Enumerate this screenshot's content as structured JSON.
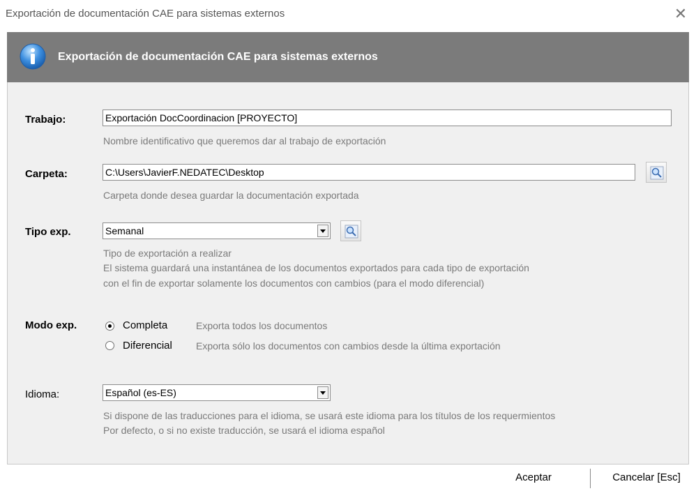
{
  "window": {
    "title": "Exportación de documentación CAE para sistemas externos",
    "close_glyph": "✕"
  },
  "header": {
    "icon": "info-icon",
    "title": "Exportación de documentación CAE para sistemas externos"
  },
  "form": {
    "trabajo": {
      "label": "Trabajo:",
      "value": "Exportación DocCoordinacion [PROYECTO]",
      "hint": "Nombre identificativo que queremos dar al trabajo de exportación"
    },
    "carpeta": {
      "label": "Carpeta:",
      "value": "C:\\Users\\JavierF.NEDATEC\\Desktop",
      "hint": "Carpeta donde desea guardar la documentación exportada",
      "button_icon": "search-icon"
    },
    "tipo_exp": {
      "label": "Tipo exp.",
      "value": "Semanal",
      "hint1": "Tipo de exportación a realizar",
      "hint2": "El sistema guardará una instantánea de los documentos exportados para cada tipo de exportación",
      "hint3": "con el fin de exportar solamente los documentos con cambios (para el modo diferencial)",
      "button_icon": "search-icon"
    },
    "modo_exp": {
      "label": "Modo exp.",
      "options": [
        {
          "label": "Completa",
          "desc": "Exporta todos los documentos",
          "selected": true
        },
        {
          "label": "Diferencial",
          "desc": "Exporta sólo los documentos con cambios desde la última exportación",
          "selected": false
        }
      ]
    },
    "idioma": {
      "label": "Idioma:",
      "value": "Español (es-ES)",
      "hint1": "Si dispone de las traducciones para el idioma, se usará este idioma para los títulos de los requermientos",
      "hint2": "Por defecto, o si no existe traducción, se usará el idioma español"
    }
  },
  "footer": {
    "accept_label": "Aceptar",
    "cancel_label": "Cancelar [Esc]"
  }
}
